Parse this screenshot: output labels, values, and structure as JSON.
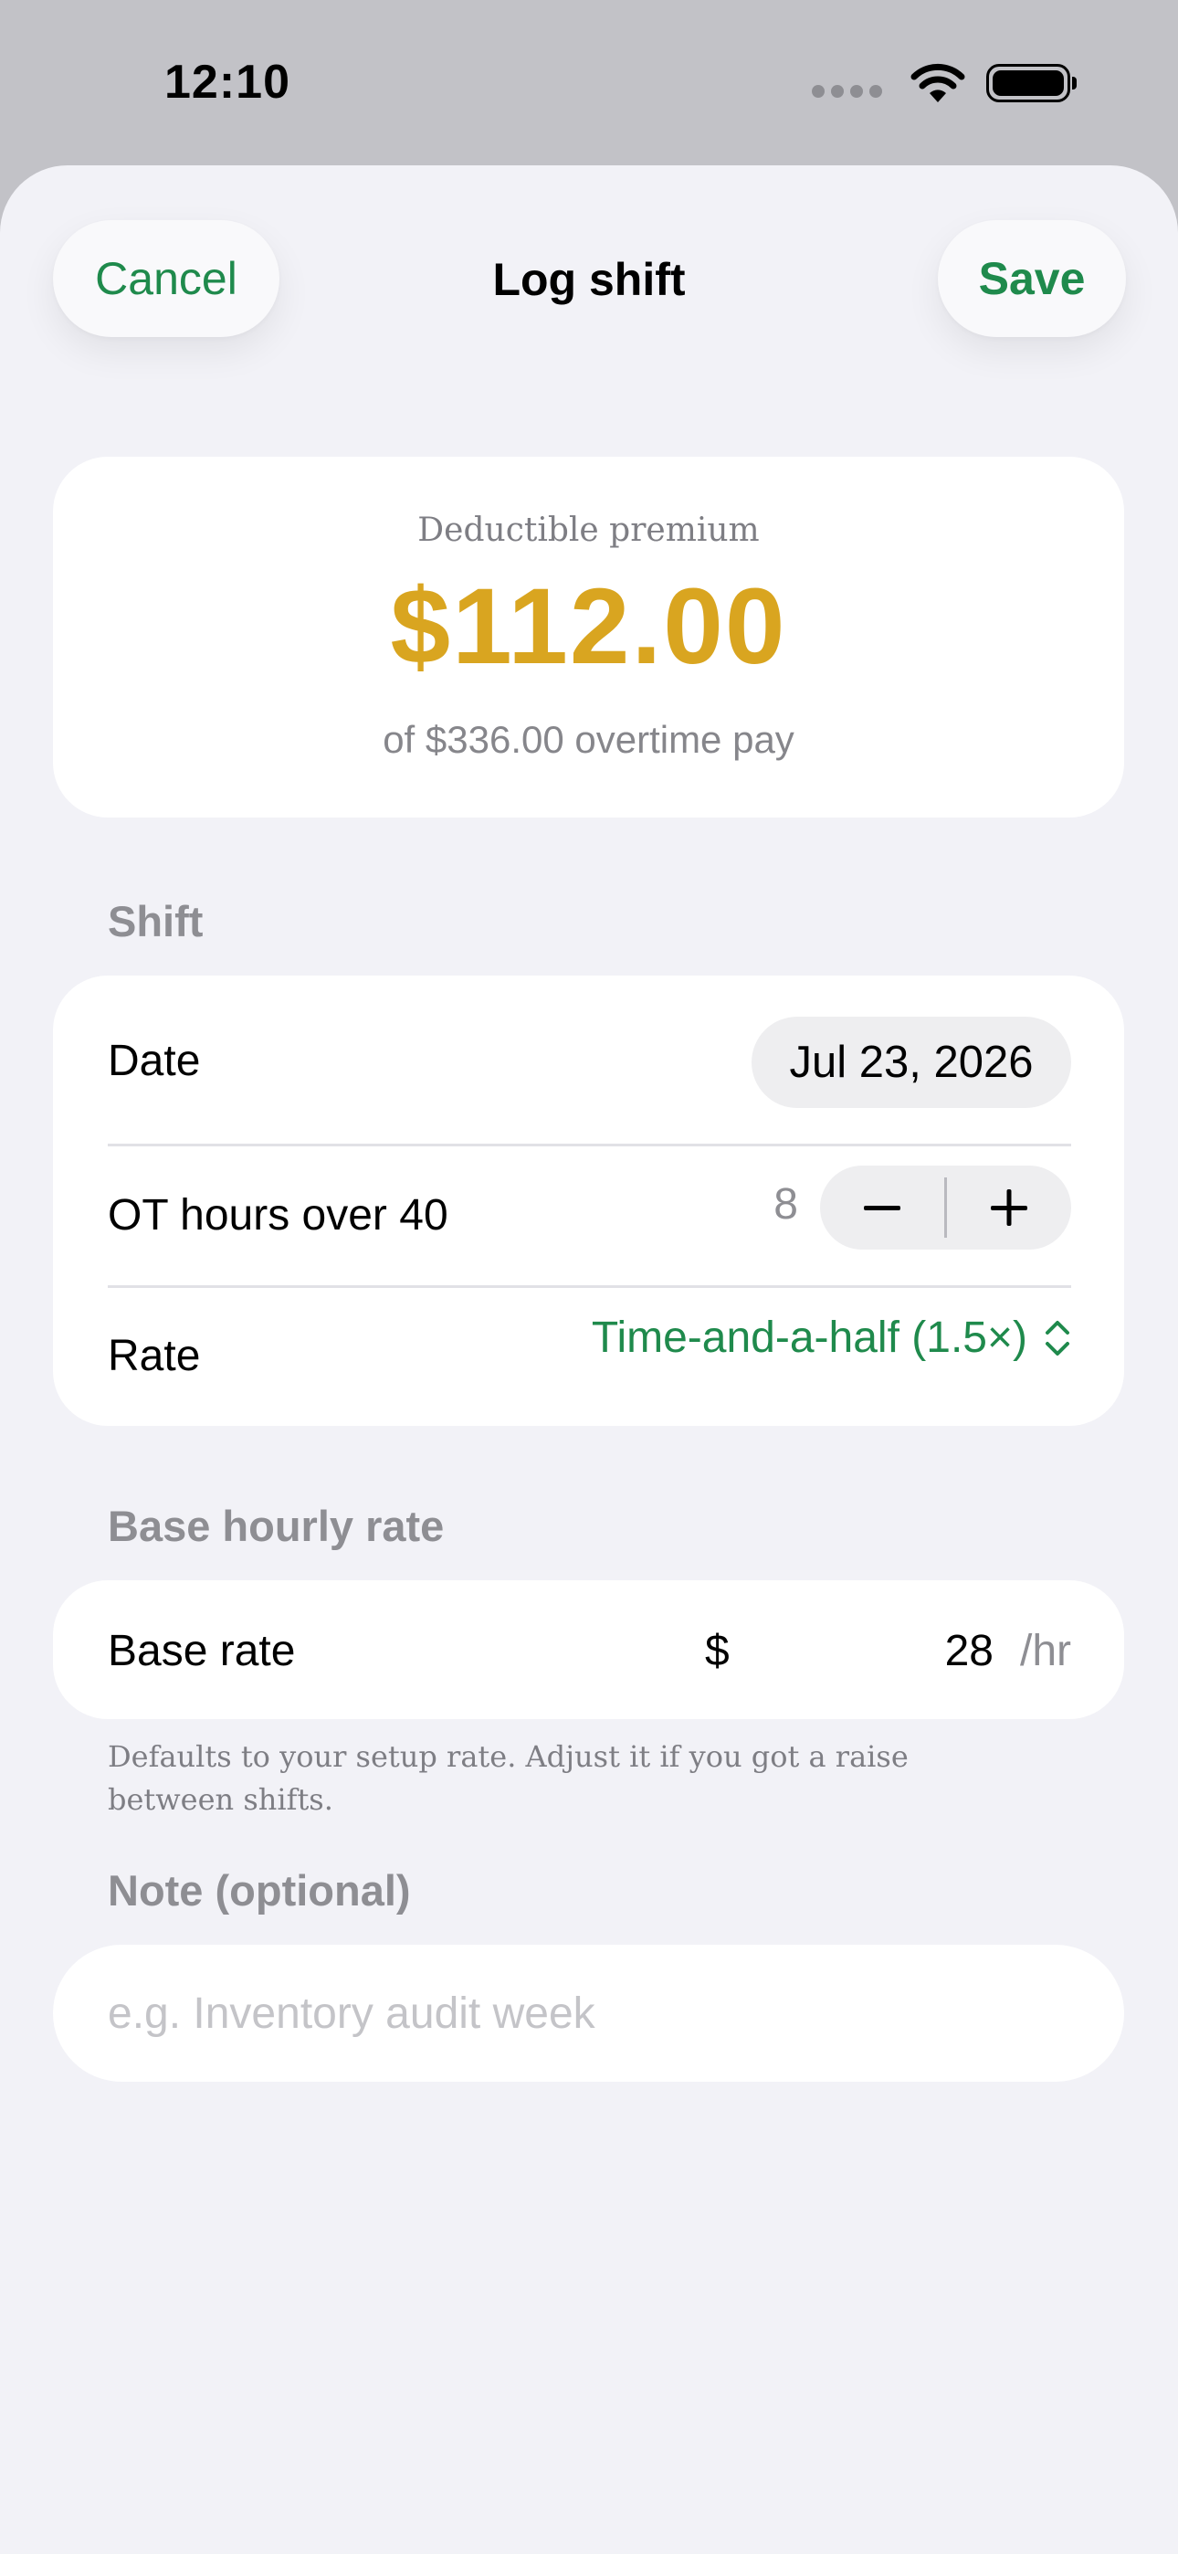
{
  "status_bar": {
    "time": "12:10"
  },
  "nav": {
    "cancel_label": "Cancel",
    "title": "Log shift",
    "save_label": "Save"
  },
  "summary": {
    "label": "Deductible premium",
    "amount": "$112.00",
    "subtitle": "of $336.00 overtime pay"
  },
  "shift_section": {
    "header": "Shift",
    "date_label": "Date",
    "date_value": "Jul 23, 2026",
    "ot_label": "OT hours over 40",
    "ot_value": "8",
    "rate_label": "Rate",
    "rate_value": "Time-and-a-half (1.5×)"
  },
  "base_section": {
    "header": "Base hourly rate",
    "label": "Base rate",
    "currency": "$",
    "value": "28",
    "unit": "/hr",
    "footnote": "Defaults to your setup rate. Adjust it if you got a raise between shifts."
  },
  "note_section": {
    "header": "Note (optional)",
    "placeholder": "e.g. Inventory audit week",
    "value": ""
  },
  "colors": {
    "accent_green": "#1f8a4c",
    "premium_gold": "#d9a520",
    "sheet_background": "#f2f2f7",
    "secondary_text": "#8e8e93"
  },
  "icons": [
    "cellular-dots-icon",
    "wifi-icon",
    "battery-icon",
    "minus-icon",
    "plus-icon",
    "chevron-up-down-icon"
  ]
}
